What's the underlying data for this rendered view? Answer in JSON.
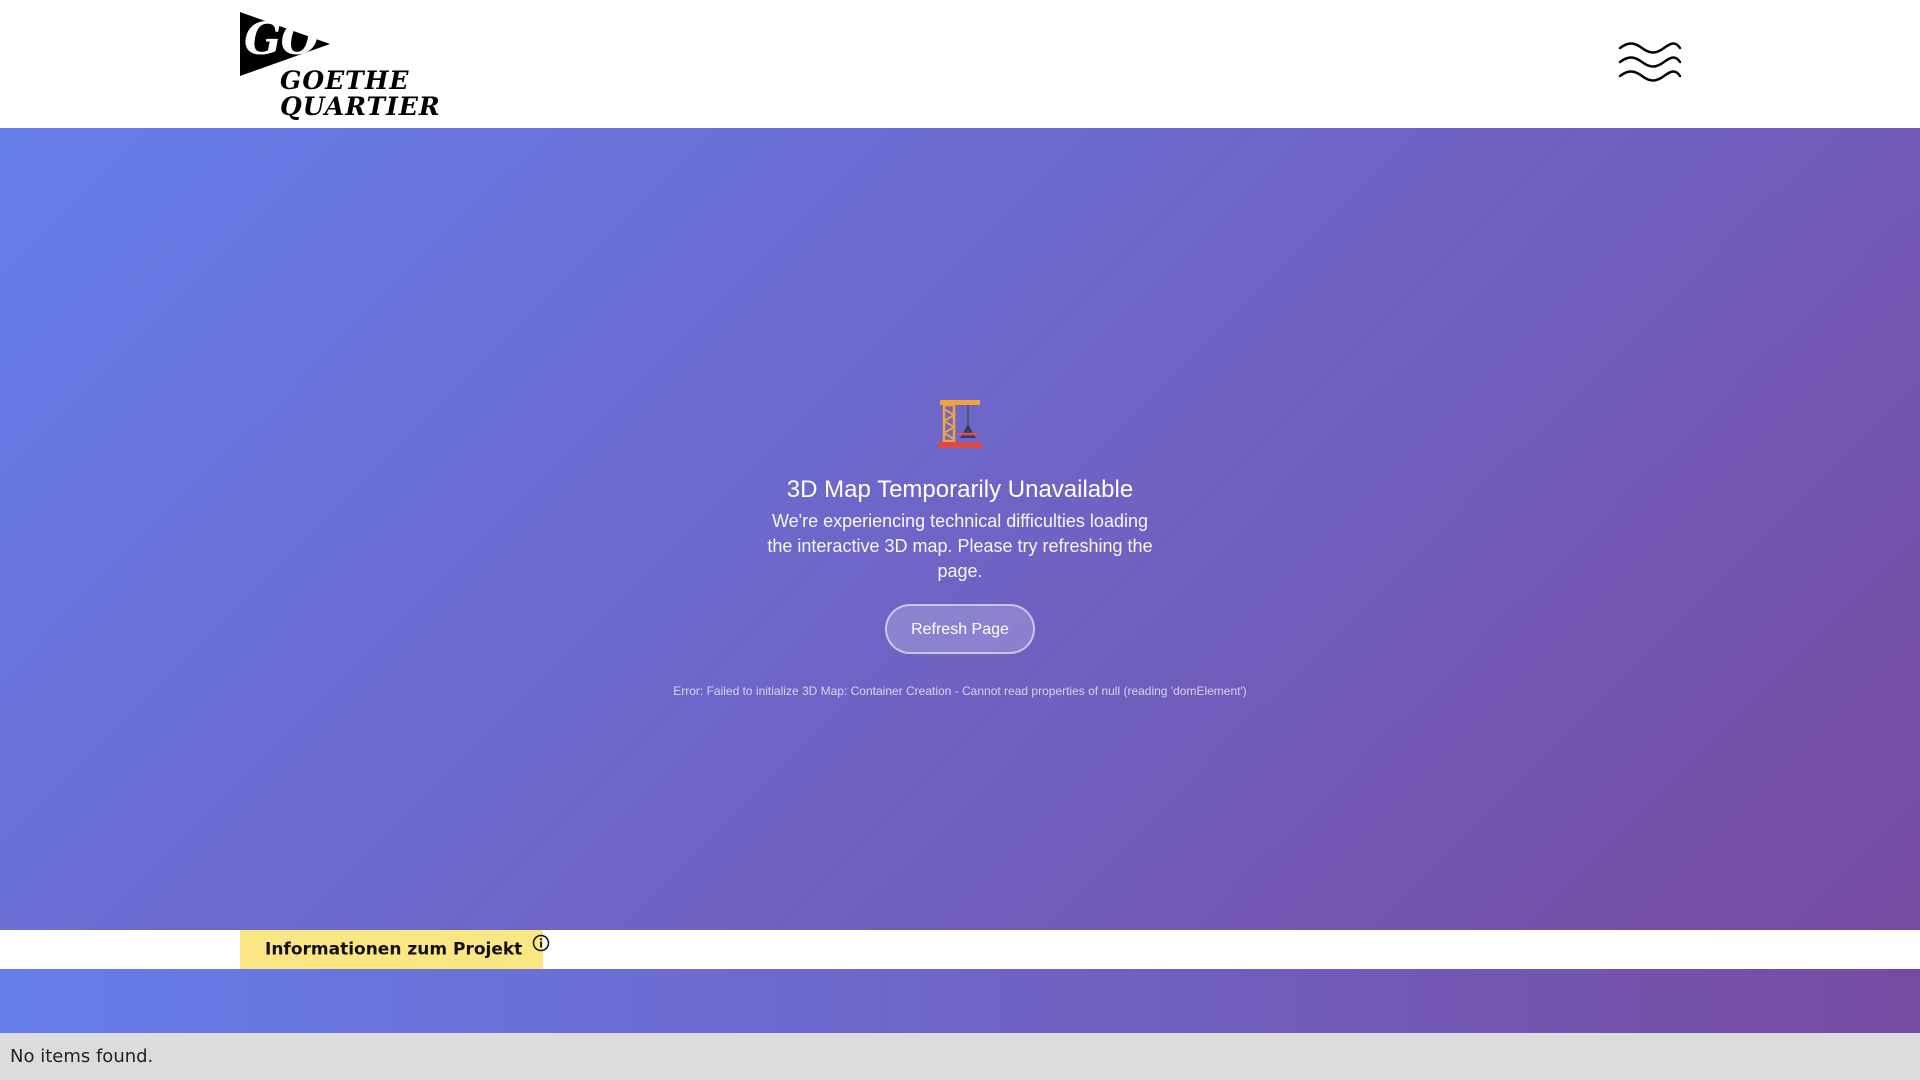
{
  "header": {
    "logo": {
      "mark_text": "GO",
      "line1": "GOETHE",
      "line2": "QUARTIER"
    },
    "menu_icon": "wavy-menu-icon"
  },
  "map": {
    "error_icon": "construction-crane-icon",
    "title": "3D Map Temporarily Unavailable",
    "message": "We're experiencing technical difficulties loading the interactive 3D map. Please try refreshing the page.",
    "refresh_label": "Refresh Page",
    "error_detail": "Error: Failed to initialize 3D Map: Container Creation - Cannot read properties of null (reading 'domElement')"
  },
  "info": {
    "label": "Informationen zum Projekt",
    "icon": "info-circle-icon"
  },
  "footer": {
    "status": "No items found."
  },
  "colors": {
    "gradient_start": "#667eea",
    "gradient_end": "#764ba2",
    "info_button_bg": "#fbe684",
    "footer_bg": "#dcdcdc"
  }
}
